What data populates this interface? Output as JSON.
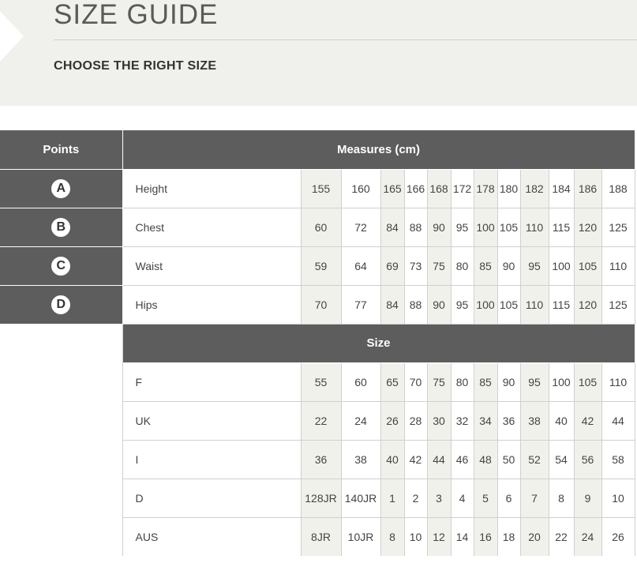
{
  "header": {
    "title": "SIZE GUIDE",
    "subtitle": "CHOOSE THE RIGHT SIZE"
  },
  "table": {
    "points_header": "Points",
    "measures_header": "Measures (cm)",
    "size_header": "Size",
    "measure_rows": [
      {
        "point": "A",
        "label": "Height",
        "values": [
          "155",
          "160",
          "165",
          "166",
          "168",
          "172",
          "178",
          "180",
          "182",
          "184",
          "186",
          "188"
        ]
      },
      {
        "point": "B",
        "label": "Chest",
        "values": [
          "60",
          "72",
          "84",
          "88",
          "90",
          "95",
          "100",
          "105",
          "110",
          "115",
          "120",
          "125"
        ]
      },
      {
        "point": "C",
        "label": "Waist",
        "values": [
          "59",
          "64",
          "69",
          "73",
          "75",
          "80",
          "85",
          "90",
          "95",
          "100",
          "105",
          "110"
        ]
      },
      {
        "point": "D",
        "label": "Hips",
        "values": [
          "70",
          "77",
          "84",
          "88",
          "90",
          "95",
          "100",
          "105",
          "110",
          "115",
          "120",
          "125"
        ]
      }
    ],
    "size_rows": [
      {
        "label": "F",
        "values": [
          "55",
          "60",
          "65",
          "70",
          "75",
          "80",
          "85",
          "90",
          "95",
          "100",
          "105",
          "110"
        ]
      },
      {
        "label": "UK",
        "values": [
          "22",
          "24",
          "26",
          "28",
          "30",
          "32",
          "34",
          "36",
          "38",
          "40",
          "42",
          "44"
        ]
      },
      {
        "label": "I",
        "values": [
          "36",
          "38",
          "40",
          "42",
          "44",
          "46",
          "48",
          "50",
          "52",
          "54",
          "56",
          "58"
        ]
      },
      {
        "label": "D",
        "values": [
          "128JR",
          "140JR",
          "1",
          "2",
          "3",
          "4",
          "5",
          "6",
          "7",
          "8",
          "9",
          "10"
        ]
      },
      {
        "label": "AUS",
        "values": [
          "8JR",
          "10JR",
          "8",
          "10",
          "12",
          "14",
          "16",
          "18",
          "20",
          "22",
          "24",
          "26"
        ]
      }
    ]
  }
}
